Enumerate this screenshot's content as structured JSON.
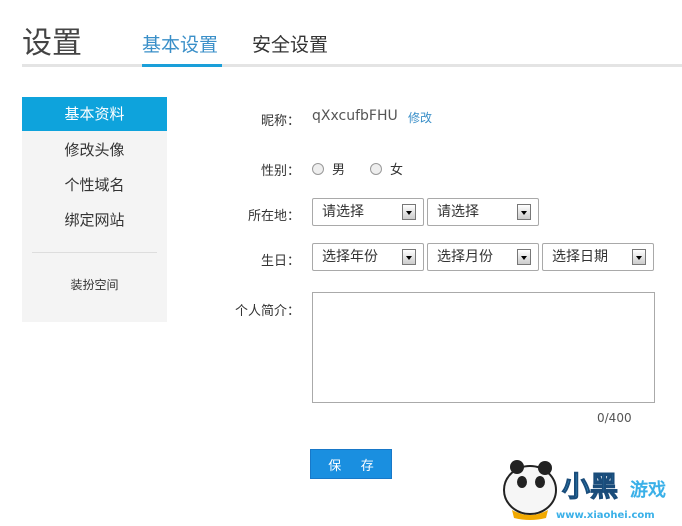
{
  "header": {
    "title": "设置",
    "tabs": [
      {
        "label": "基本设置",
        "active": true
      },
      {
        "label": "安全设置",
        "active": false
      }
    ]
  },
  "sidebar": {
    "items": [
      {
        "label": "基本资料",
        "active": true
      },
      {
        "label": "修改头像"
      },
      {
        "label": "个性域名"
      },
      {
        "label": "绑定网站"
      }
    ],
    "extra": "装扮空间"
  },
  "form": {
    "nickname": {
      "label": "昵称：",
      "value": "qXxcufbFHU",
      "edit": "修改"
    },
    "gender": {
      "label": "性别：",
      "options": [
        "男",
        "女"
      ]
    },
    "location": {
      "label": "所在地：",
      "selects": [
        "请选择",
        "请选择"
      ]
    },
    "birthday": {
      "label": "生日：",
      "selects": [
        "选择年份",
        "选择月份",
        "选择日期"
      ]
    },
    "bio": {
      "label": "个人简介：",
      "value": "",
      "counter": "0/400"
    },
    "save": "保 存"
  },
  "watermark": {
    "text": "小黑游戏",
    "url": "www.xiaohei.com"
  },
  "colors": {
    "accent": "#0ea3dc",
    "button": "#1a8fe0"
  }
}
